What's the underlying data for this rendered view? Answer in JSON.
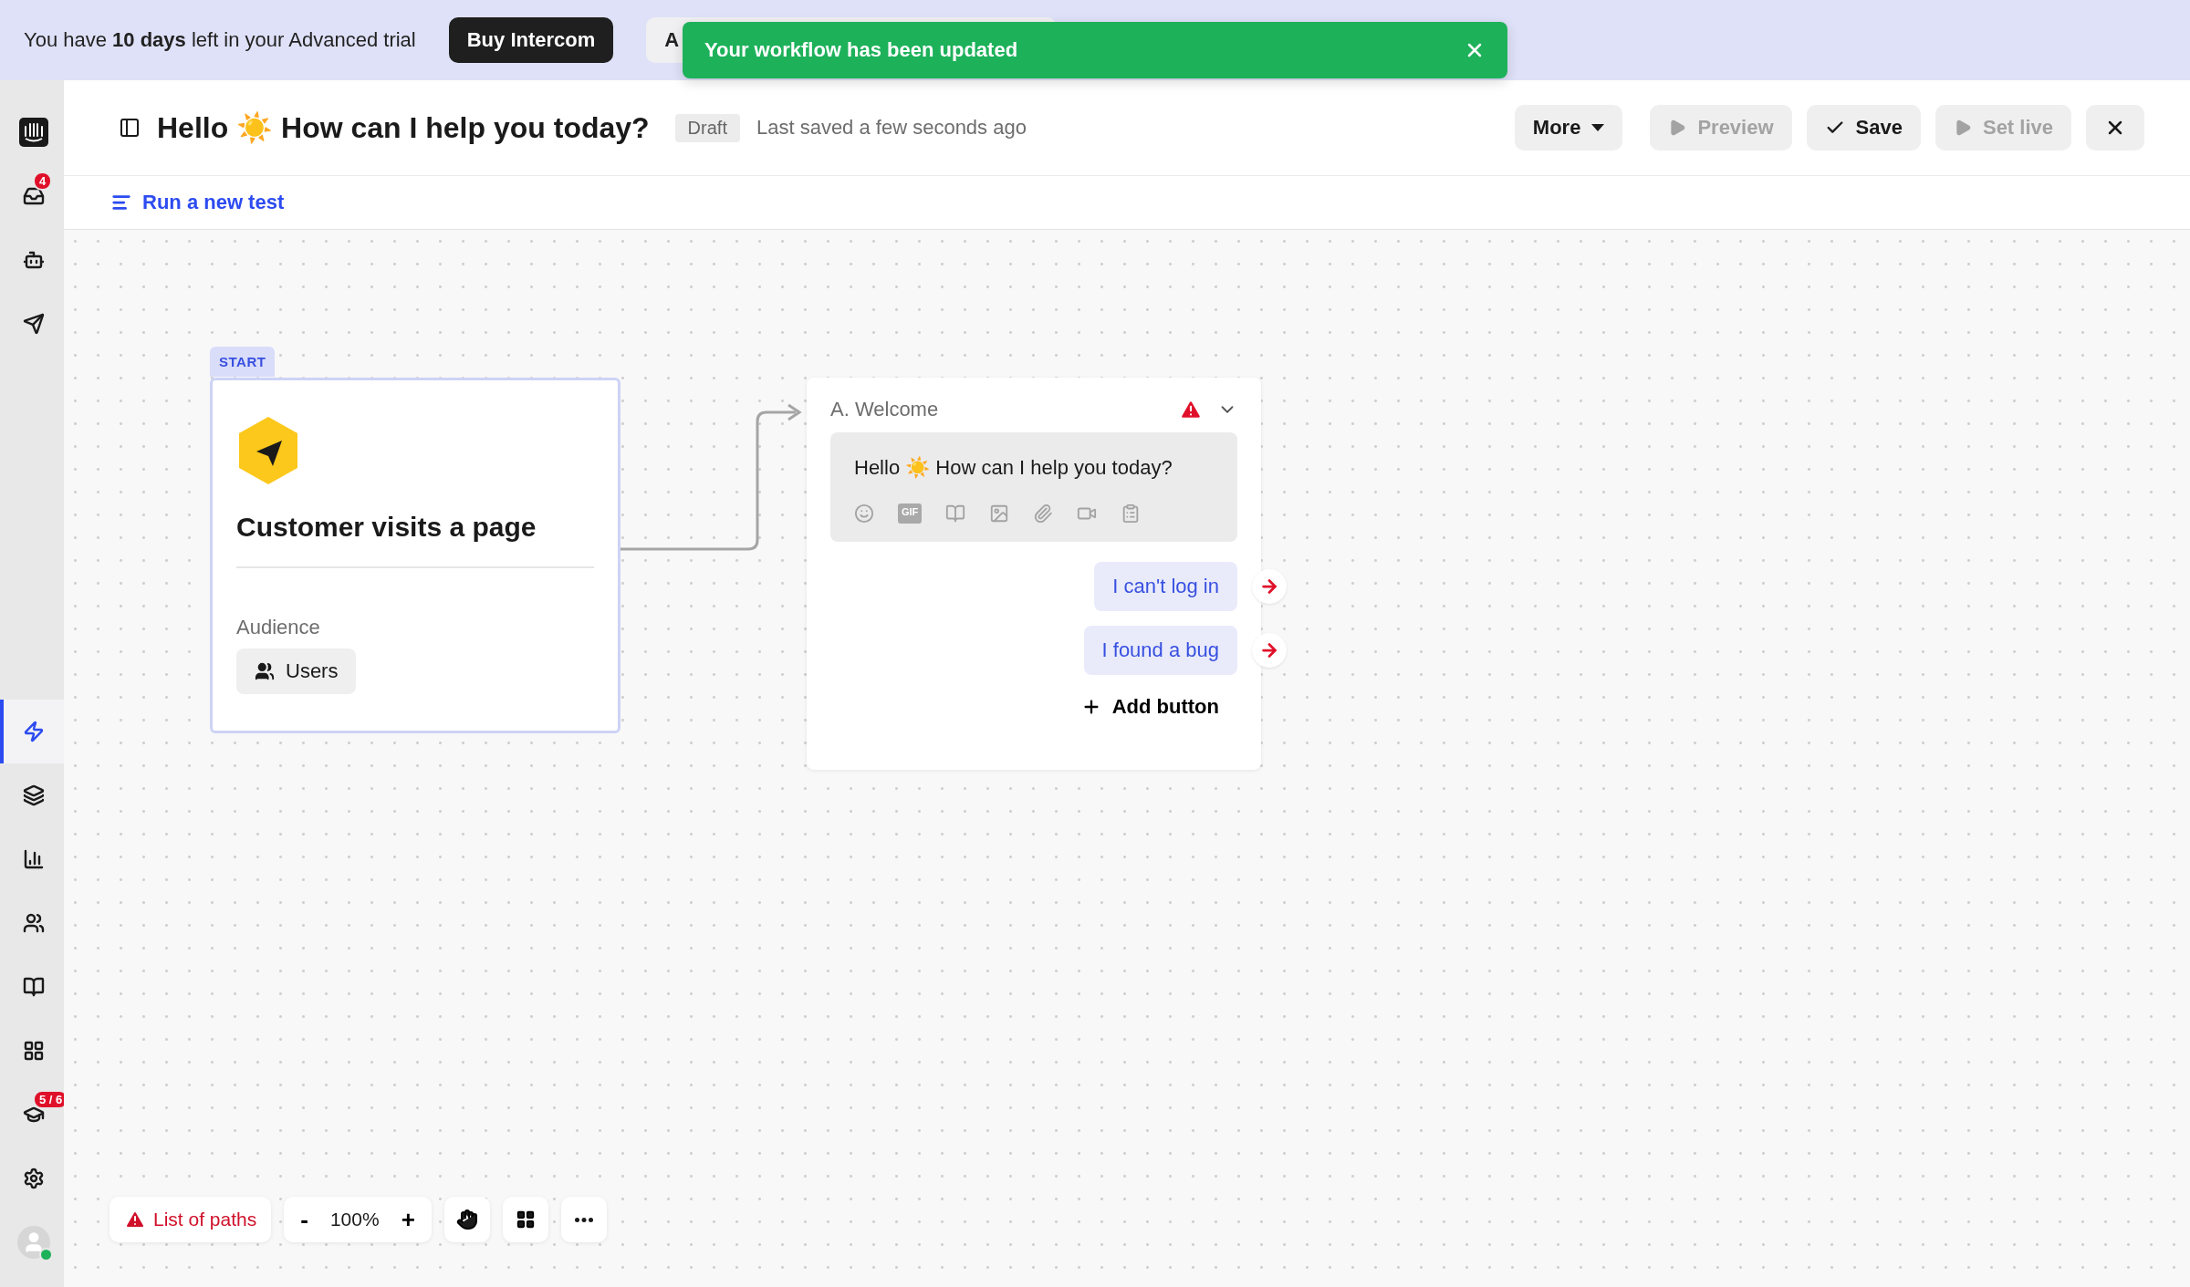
{
  "banner": {
    "text": "You have **10 days** left in your Advanced trial",
    "buttons": [
      {
        "label": "Buy Intercom",
        "kind": "primary"
      },
      {
        "label": "A",
        "kind": "secondary"
      }
    ]
  },
  "toast": {
    "text": "Your workflow has been updated"
  },
  "sidebar": {
    "items": [
      {
        "kind": "logo",
        "selected": false
      },
      {
        "kind": "inbox",
        "selected": false,
        "badge": "4"
      },
      {
        "kind": "bot",
        "selected": false
      },
      {
        "kind": "send",
        "selected": false
      },
      {
        "kind": "zap",
        "selected": true
      },
      {
        "kind": "layers",
        "selected": false
      },
      {
        "kind": "chart",
        "selected": false
      },
      {
        "kind": "users",
        "selected": false
      },
      {
        "kind": "book",
        "selected": false
      },
      {
        "kind": "apps",
        "selected": false
      },
      {
        "kind": "cap",
        "selected": false,
        "badge": "5 / 6"
      },
      {
        "kind": "settings",
        "selected": false
      },
      {
        "kind": "avatar",
        "selected": false
      }
    ]
  },
  "header": {
    "title": "Hello ☀️ How can I help you today?",
    "status": "Draft",
    "saved": "Last saved a few seconds ago",
    "actions": [
      {
        "label": "More",
        "kind": "dropdown",
        "disabled": false
      },
      {
        "label": "Preview",
        "kind": "play",
        "disabled": true
      },
      {
        "label": "Save",
        "kind": "check",
        "disabled": false
      },
      {
        "label": "Set live",
        "kind": "play",
        "disabled": true
      },
      {
        "kind": "close",
        "disabled": false
      }
    ]
  },
  "test_link": "Run a new test",
  "start": {
    "tag": "START",
    "title": "Customer visits a page",
    "audience_label": "Audience",
    "audience": "Users"
  },
  "step": {
    "title": "A. Welcome",
    "warning": true,
    "message": "Hello ☀️ How can I help you today?",
    "tools": [
      {
        "kind": "emoji"
      },
      {
        "kind": "gif",
        "label": "GIF"
      },
      {
        "kind": "book"
      },
      {
        "kind": "image"
      },
      {
        "kind": "attach"
      },
      {
        "kind": "video"
      },
      {
        "kind": "clipboard"
      }
    ],
    "replies": [
      "I can't log in",
      "I found a bug"
    ],
    "add": "Add button"
  },
  "toolbar": {
    "paths": "List of paths",
    "zoom": "100%",
    "minus": "-",
    "plus": "+"
  }
}
